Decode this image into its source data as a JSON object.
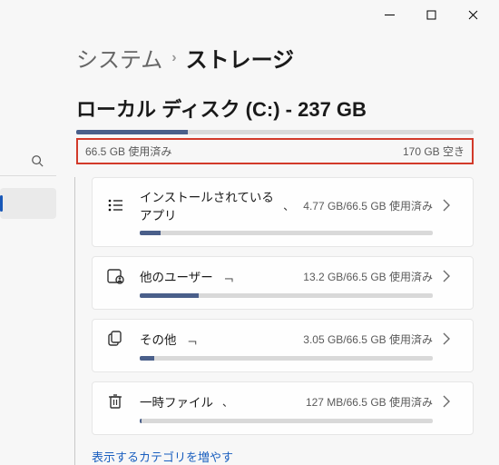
{
  "window": {
    "minimize": "–",
    "maximize": "▢",
    "close": "✕"
  },
  "breadcrumb": {
    "parent": "システム",
    "sep": "›",
    "current": "ストレージ"
  },
  "drive": {
    "title": "ローカル ディスク (C:) - 237 GB",
    "used_label": "66.5 GB 使用済み",
    "free_label": "170 GB 空き",
    "fill_pct": 28
  },
  "cards": [
    {
      "label": "インストールされているアプリ",
      "detail": "4.77 GB/66.5 GB 使用済み",
      "fill_pct": 7,
      "mark": "、"
    },
    {
      "label": "他のユーザー",
      "detail": "13.2 GB/66.5 GB 使用済み",
      "fill_pct": 20,
      "mark": "﹁"
    },
    {
      "label": "その他",
      "detail": "3.05 GB/66.5 GB 使用済み",
      "fill_pct": 5,
      "mark": "﹁"
    },
    {
      "label": "一時ファイル",
      "detail": "127 MB/66.5 GB 使用済み",
      "fill_pct": 0.5,
      "mark": "、"
    }
  ],
  "more_link": "表示するカテゴリを増やす",
  "colors": {
    "accent": "#4a5f8a",
    "highlight_border": "#d23a2a",
    "link": "#1a5fbf"
  }
}
